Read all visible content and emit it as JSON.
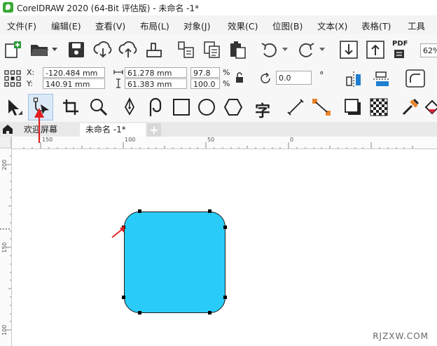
{
  "window": {
    "title": "CorelDRAW 2020 (64-Bit 评估版) - 未命名 -1*"
  },
  "menu": [
    "文件(F)",
    "编辑(E)",
    "查看(V)",
    "布局(L)",
    "对象(J)",
    "效果(C)",
    "位图(B)",
    "文本(X)",
    "表格(T)",
    "工具"
  ],
  "toolbar": {
    "pdf_label": "PDF",
    "zoom": "62%"
  },
  "properties": {
    "x_label": "X:",
    "y_label": "Y:",
    "x_value": "-120.484 mm",
    "y_value": "140.91 mm",
    "width_value": "61.278 mm",
    "height_value": "61.383 mm",
    "scale_x": "97.8",
    "scale_y": "100.0",
    "percent": "%",
    "rotation": "0.0",
    "degree": "°"
  },
  "toolbox": {
    "text_tool_glyph": "字"
  },
  "tabs": {
    "welcome": "欢迎屏幕",
    "document": "未命名 -1*",
    "add": "+"
  },
  "ruler_h": [
    "150",
    "100",
    "50",
    "0"
  ],
  "ruler_v": [
    "200",
    "150",
    "100"
  ],
  "colors": {
    "shape_fill": "#29ccf8",
    "annotation_arrow": "#e02020",
    "app_icon": "#3aa935"
  },
  "watermark": "RJZXW.COM"
}
